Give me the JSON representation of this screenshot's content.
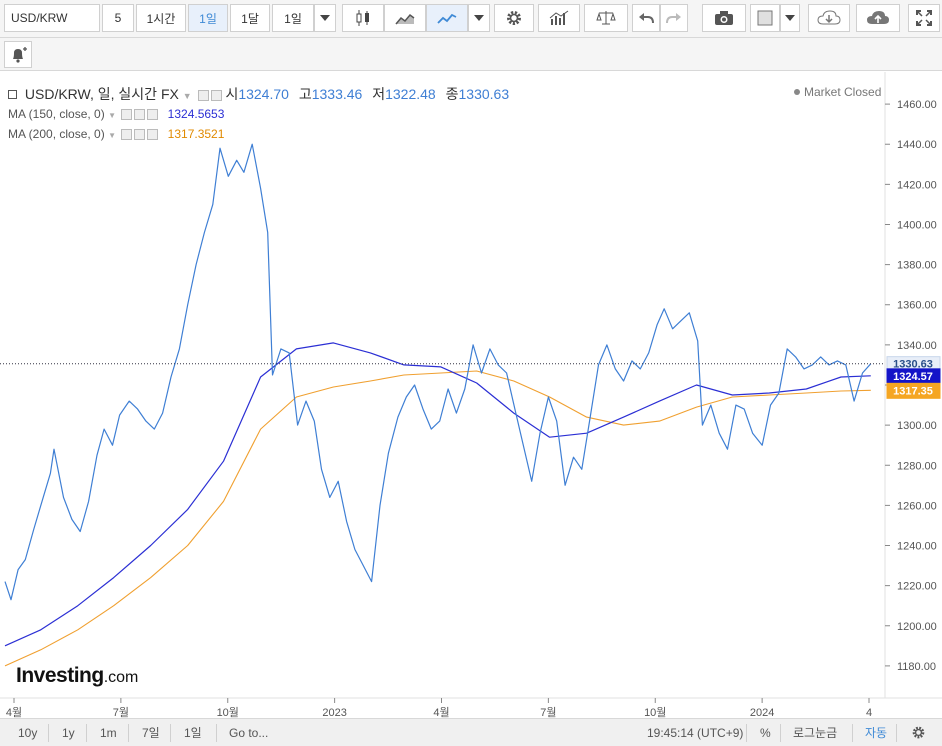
{
  "toolbar": {
    "symbol": "USD/KRW",
    "intervals": [
      "5",
      "1시간",
      "1일",
      "1달",
      "1일"
    ],
    "active_interval": "1일",
    "icons": [
      "chevron-down-icon",
      "candlestick-icon",
      "area-chart-icon",
      "line-chart-icon",
      "chevron-down-icon",
      "gear-icon",
      "indicators-icon",
      "compare-icon",
      "undo-icon",
      "redo-icon",
      "camera-icon",
      "color-box-icon",
      "chevron-down-icon",
      "cloud-download-icon",
      "cloud-upload-icon",
      "fullscreen-icon"
    ]
  },
  "legend": {
    "title": "USD/KRW, 일, 실시간 FX",
    "open_label": "시",
    "open": "1324.70",
    "high_label": "고",
    "high": "1333.46",
    "low_label": "저",
    "low": "1322.48",
    "close_label": "종",
    "close": "1330.63",
    "status": "Market Closed",
    "ma150_label": "MA (150, close, 0)",
    "ma150_value": "1324.5653",
    "ma200_label": "MA (200, close, 0)",
    "ma200_value": "1317.3521"
  },
  "watermark": {
    "brand": "Investing",
    "suffix": ".com"
  },
  "colors": {
    "price": "#3f7fd4",
    "ma150": "#2b2fd4",
    "ma200": "#f0a030",
    "ma150_tag": "#1414c8",
    "ma200_tag": "#f5a623",
    "price_tag": "#3f7fd4"
  },
  "chart_data": {
    "type": "line",
    "title": "USD/KRW, 일, 실시간 FX",
    "x_labels": [
      "4월",
      "7월",
      "10월",
      "2023",
      "4월",
      "7월",
      "10월",
      "2024",
      "4"
    ],
    "x_start": "2022-04",
    "x_end": "2024-04",
    "ylim": [
      1164,
      1476
    ],
    "yticks": [
      1180,
      1200,
      1220,
      1240,
      1260,
      1280,
      1300,
      1320,
      1340,
      1360,
      1380,
      1400,
      1420,
      1440,
      1460
    ],
    "grid": false,
    "series": [
      {
        "name": "USD/KRW",
        "points": [
          [
            "2022-04-01",
            1222
          ],
          [
            "2022-04-06",
            1213
          ],
          [
            "2022-04-12",
            1228
          ],
          [
            "2022-04-18",
            1233
          ],
          [
            "2022-04-25",
            1248
          ],
          [
            "2022-05-02",
            1262
          ],
          [
            "2022-05-09",
            1276
          ],
          [
            "2022-05-12",
            1288
          ],
          [
            "2022-05-20",
            1264
          ],
          [
            "2022-05-27",
            1253
          ],
          [
            "2022-06-03",
            1247
          ],
          [
            "2022-06-10",
            1262
          ],
          [
            "2022-06-17",
            1285
          ],
          [
            "2022-06-23",
            1298
          ],
          [
            "2022-06-30",
            1290
          ],
          [
            "2022-07-06",
            1305
          ],
          [
            "2022-07-14",
            1312
          ],
          [
            "2022-07-21",
            1308
          ],
          [
            "2022-07-28",
            1302
          ],
          [
            "2022-08-04",
            1298
          ],
          [
            "2022-08-11",
            1306
          ],
          [
            "2022-08-18",
            1324
          ],
          [
            "2022-08-25",
            1338
          ],
          [
            "2022-09-01",
            1360
          ],
          [
            "2022-09-08",
            1380
          ],
          [
            "2022-09-15",
            1396
          ],
          [
            "2022-09-22",
            1410
          ],
          [
            "2022-09-28",
            1438
          ],
          [
            "2022-10-05",
            1424
          ],
          [
            "2022-10-12",
            1432
          ],
          [
            "2022-10-18",
            1426
          ],
          [
            "2022-10-25",
            1440
          ],
          [
            "2022-11-01",
            1418
          ],
          [
            "2022-11-07",
            1396
          ],
          [
            "2022-11-11",
            1325
          ],
          [
            "2022-11-18",
            1338
          ],
          [
            "2022-11-25",
            1336
          ],
          [
            "2022-12-02",
            1300
          ],
          [
            "2022-12-09",
            1312
          ],
          [
            "2022-12-16",
            1302
          ],
          [
            "2022-12-22",
            1278
          ],
          [
            "2022-12-29",
            1264
          ],
          [
            "2023-01-05",
            1272
          ],
          [
            "2023-01-12",
            1252
          ],
          [
            "2023-01-19",
            1238
          ],
          [
            "2023-01-26",
            1230
          ],
          [
            "2023-02-02",
            1222
          ],
          [
            "2023-02-09",
            1260
          ],
          [
            "2023-02-16",
            1286
          ],
          [
            "2023-02-24",
            1304
          ],
          [
            "2023-03-03",
            1314
          ],
          [
            "2023-03-10",
            1320
          ],
          [
            "2023-03-17",
            1308
          ],
          [
            "2023-03-24",
            1298
          ],
          [
            "2023-03-31",
            1302
          ],
          [
            "2023-04-07",
            1318
          ],
          [
            "2023-04-14",
            1306
          ],
          [
            "2023-04-21",
            1318
          ],
          [
            "2023-04-28",
            1340
          ],
          [
            "2023-05-05",
            1326
          ],
          [
            "2023-05-12",
            1338
          ],
          [
            "2023-05-19",
            1330
          ],
          [
            "2023-05-26",
            1326
          ],
          [
            "2023-06-02",
            1308
          ],
          [
            "2023-06-09",
            1290
          ],
          [
            "2023-06-16",
            1272
          ],
          [
            "2023-06-23",
            1296
          ],
          [
            "2023-06-30",
            1314
          ],
          [
            "2023-07-07",
            1302
          ],
          [
            "2023-07-14",
            1270
          ],
          [
            "2023-07-21",
            1284
          ],
          [
            "2023-07-28",
            1278
          ],
          [
            "2023-08-04",
            1304
          ],
          [
            "2023-08-11",
            1330
          ],
          [
            "2023-08-18",
            1340
          ],
          [
            "2023-08-25",
            1328
          ],
          [
            "2023-09-01",
            1322
          ],
          [
            "2023-09-08",
            1332
          ],
          [
            "2023-09-15",
            1328
          ],
          [
            "2023-09-22",
            1336
          ],
          [
            "2023-09-29",
            1350
          ],
          [
            "2023-10-05",
            1358
          ],
          [
            "2023-10-12",
            1348
          ],
          [
            "2023-10-19",
            1352
          ],
          [
            "2023-10-26",
            1356
          ],
          [
            "2023-11-02",
            1342
          ],
          [
            "2023-11-06",
            1300
          ],
          [
            "2023-11-13",
            1310
          ],
          [
            "2023-11-20",
            1296
          ],
          [
            "2023-11-27",
            1288
          ],
          [
            "2023-12-04",
            1310
          ],
          [
            "2023-12-11",
            1308
          ],
          [
            "2023-12-18",
            1296
          ],
          [
            "2023-12-26",
            1290
          ],
          [
            "2024-01-02",
            1310
          ],
          [
            "2024-01-09",
            1316
          ],
          [
            "2024-01-16",
            1338
          ],
          [
            "2024-01-23",
            1334
          ],
          [
            "2024-01-30",
            1328
          ],
          [
            "2024-02-06",
            1330
          ],
          [
            "2024-02-13",
            1334
          ],
          [
            "2024-02-20",
            1330
          ],
          [
            "2024-02-27",
            1332
          ],
          [
            "2024-03-05",
            1330
          ],
          [
            "2024-03-12",
            1312
          ],
          [
            "2024-03-19",
            1326
          ],
          [
            "2024-03-26",
            1330.63
          ]
        ]
      },
      {
        "name": "MA (150, close, 0)",
        "points": [
          [
            "2022-04-01",
            1190
          ],
          [
            "2022-05-01",
            1198
          ],
          [
            "2022-06-01",
            1210
          ],
          [
            "2022-07-01",
            1224
          ],
          [
            "2022-08-01",
            1240
          ],
          [
            "2022-09-01",
            1258
          ],
          [
            "2022-10-01",
            1282
          ],
          [
            "2022-11-01",
            1324
          ],
          [
            "2022-12-01",
            1338
          ],
          [
            "2023-01-01",
            1341
          ],
          [
            "2023-02-01",
            1336
          ],
          [
            "2023-03-01",
            1330
          ],
          [
            "2023-04-01",
            1329
          ],
          [
            "2023-05-01",
            1321
          ],
          [
            "2023-06-01",
            1306
          ],
          [
            "2023-07-01",
            1294
          ],
          [
            "2023-08-01",
            1296
          ],
          [
            "2023-09-01",
            1304
          ],
          [
            "2023-10-01",
            1312
          ],
          [
            "2023-11-01",
            1320
          ],
          [
            "2023-12-01",
            1315
          ],
          [
            "2024-01-01",
            1316
          ],
          [
            "2024-02-01",
            1318
          ],
          [
            "2024-03-01",
            1324
          ],
          [
            "2024-03-26",
            1324.57
          ]
        ]
      },
      {
        "name": "MA (200, close, 0)",
        "points": [
          [
            "2022-04-01",
            1180
          ],
          [
            "2022-05-01",
            1188
          ],
          [
            "2022-06-01",
            1198
          ],
          [
            "2022-07-01",
            1210
          ],
          [
            "2022-08-01",
            1224
          ],
          [
            "2022-09-01",
            1240
          ],
          [
            "2022-10-01",
            1262
          ],
          [
            "2022-11-01",
            1298
          ],
          [
            "2022-12-01",
            1314
          ],
          [
            "2023-01-01",
            1319
          ],
          [
            "2023-02-01",
            1322
          ],
          [
            "2023-03-01",
            1325
          ],
          [
            "2023-04-01",
            1326
          ],
          [
            "2023-05-01",
            1327
          ],
          [
            "2023-06-01",
            1322
          ],
          [
            "2023-07-01",
            1314
          ],
          [
            "2023-08-01",
            1304
          ],
          [
            "2023-09-01",
            1300
          ],
          [
            "2023-10-01",
            1302
          ],
          [
            "2023-11-01",
            1309
          ],
          [
            "2023-12-01",
            1314
          ],
          [
            "2024-01-01",
            1315
          ],
          [
            "2024-02-01",
            1316
          ],
          [
            "2024-03-01",
            1317
          ],
          [
            "2024-03-26",
            1317.35
          ]
        ]
      }
    ],
    "last_price": 1330.63,
    "ma150_last": 1324.57,
    "ma200_last": 1317.35
  },
  "bottom": {
    "ranges": [
      "10y",
      "1y",
      "1m",
      "7일",
      "1일"
    ],
    "goto": "Go to...",
    "time": "19:45:14 (UTC+9)",
    "percent": "%",
    "log": "로그눈금",
    "auto": "자동"
  }
}
